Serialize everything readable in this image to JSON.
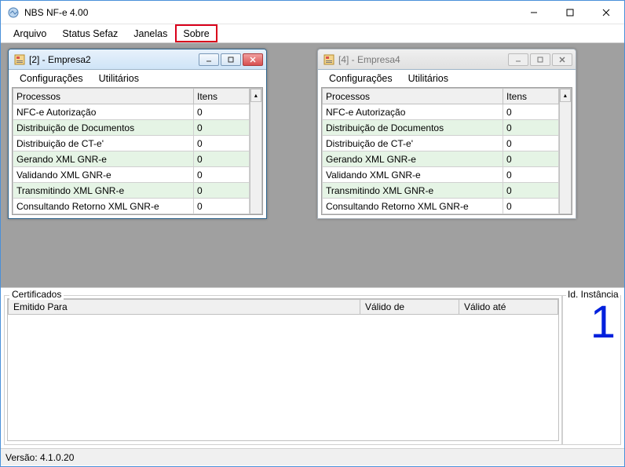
{
  "app": {
    "title": "NBS NF-e 4.00"
  },
  "menubar": {
    "arquivo": "Arquivo",
    "status_sefaz": "Status Sefaz",
    "janelas": "Janelas",
    "sobre": "Sobre"
  },
  "child_windows": [
    {
      "title": "[2] - Empresa2",
      "active": true,
      "menu": {
        "configuracoes": "Configurações",
        "utilitarios": "Utilitários"
      },
      "columns": {
        "processos": "Processos",
        "itens": "Itens"
      },
      "rows": [
        {
          "processo": "NFC-e Autorização",
          "itens": "0"
        },
        {
          "processo": "Distribuição de Documentos",
          "itens": "0"
        },
        {
          "processo": "Distribuição de CT-e'",
          "itens": "0"
        },
        {
          "processo": "Gerando XML GNR-e",
          "itens": "0"
        },
        {
          "processo": "Validando XML GNR-e",
          "itens": "0"
        },
        {
          "processo": "Transmitindo XML GNR-e",
          "itens": "0"
        },
        {
          "processo": "Consultando Retorno XML GNR-e",
          "itens": "0"
        }
      ]
    },
    {
      "title": "[4] - Empresa4",
      "active": false,
      "menu": {
        "configuracoes": "Configurações",
        "utilitarios": "Utilitários"
      },
      "columns": {
        "processos": "Processos",
        "itens": "Itens"
      },
      "rows": [
        {
          "processo": "NFC-e Autorização",
          "itens": "0"
        },
        {
          "processo": "Distribuição de Documentos",
          "itens": "0"
        },
        {
          "processo": "Distribuição de CT-e'",
          "itens": "0"
        },
        {
          "processo": "Gerando XML GNR-e",
          "itens": "0"
        },
        {
          "processo": "Validando XML GNR-e",
          "itens": "0"
        },
        {
          "processo": "Transmitindo XML GNR-e",
          "itens": "0"
        },
        {
          "processo": "Consultando Retorno XML GNR-e",
          "itens": "0"
        }
      ]
    }
  ],
  "certificados": {
    "legend": "Certificados",
    "columns": {
      "emitido_para": "Emitido Para",
      "valido_de": "Válido de",
      "valido_ate": "Válido até"
    }
  },
  "instancia": {
    "legend": "Id. Instância",
    "value": "1"
  },
  "statusbar": {
    "versao": "Versão: 4.1.0.20"
  }
}
